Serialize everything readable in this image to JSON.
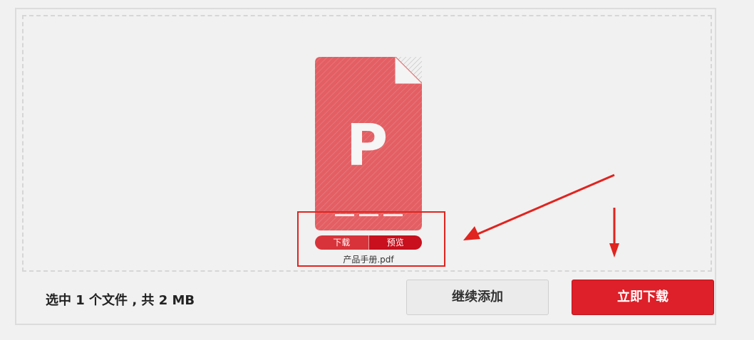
{
  "file": {
    "icon_letter": "P",
    "icon": "pdf-file-icon",
    "name": "产品手册.pdf",
    "download_label": "下载",
    "preview_label": "预览"
  },
  "summary_text": "选中 1 个文件 , 共 2 MB",
  "buttons": {
    "continue_label": "继续添加",
    "download_now_label": "立即下载"
  },
  "colors": {
    "file_red": "#e35f63",
    "accent_red": "#dd2029",
    "annotation_red": "#e0241f"
  }
}
